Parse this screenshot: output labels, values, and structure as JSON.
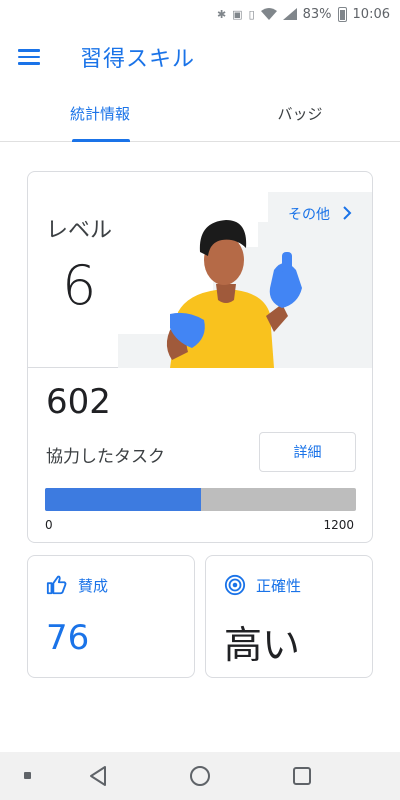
{
  "status_bar": {
    "battery": "83%",
    "time": "10:06"
  },
  "app_bar": {
    "title": "習得スキル"
  },
  "tabs": [
    {
      "label": "統計情報",
      "active": true
    },
    {
      "label": "バッジ",
      "active": false
    }
  ],
  "level_card": {
    "level_label": "レベル",
    "level_value": "6",
    "more_link": "その他",
    "count_value": "602",
    "tasks_label": "協力したタスク",
    "details_button": "詳細",
    "progress": {
      "value": 602,
      "min": 0,
      "max": 1200,
      "min_label": "0",
      "max_label": "1200"
    }
  },
  "stat_cards": {
    "upvotes": {
      "label": "賛成",
      "value": "76",
      "icon": "thumbs-up-icon"
    },
    "accuracy": {
      "label": "正確性",
      "value": "高い",
      "icon": "target-icon"
    }
  },
  "colors": {
    "accent": "#1a73e8",
    "progress_fill": "#3d7be0",
    "progress_track": "#bdbdbd"
  }
}
